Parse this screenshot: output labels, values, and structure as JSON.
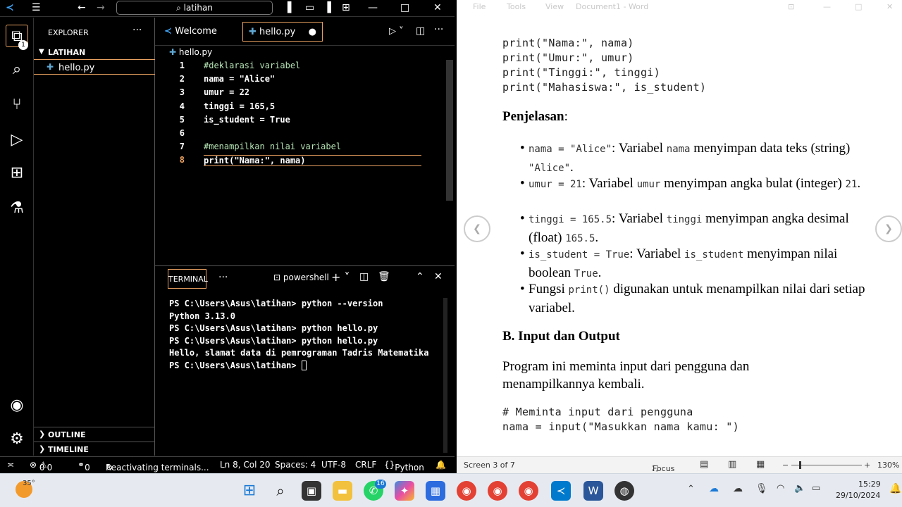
{
  "vscode": {
    "command_center": "latihan",
    "explorer_title": "EXPLORER",
    "folder_name": "LATIHAN",
    "file_name": "hello.py",
    "explorer_badge": "1",
    "tabs": [
      {
        "label": "Welcome"
      },
      {
        "label": "hello.py"
      }
    ],
    "breadcrumb": "hello.py",
    "code": [
      {
        "n": "1",
        "t": "#deklarasi variabel"
      },
      {
        "n": "2",
        "t": "nama = \"Alice\""
      },
      {
        "n": "3",
        "t": "umur = 22"
      },
      {
        "n": "4",
        "t": "tinggi = 165,5"
      },
      {
        "n": "5",
        "t": "is_student = True"
      },
      {
        "n": "6",
        "t": ""
      },
      {
        "n": "7",
        "t": "#menampilkan nilai variabel"
      },
      {
        "n": "8",
        "t": "print(\"Nama:\", nama)"
      }
    ],
    "terminal_tab": "TERMINAL",
    "shell": "powershell",
    "terminal_lines": [
      "PS C:\\Users\\Asus\\latihan> python --version",
      "Python 3.13.0",
      "PS C:\\Users\\Asus\\latihan> python hello.py",
      "PS C:\\Users\\Asus\\latihan> python hello.py",
      "Hello, slamat data di pemrograman Tadris Matematika",
      "PS C:\\Users\\Asus\\latihan> "
    ],
    "outline": "OUTLINE",
    "timeline": "TIMELINE",
    "status": {
      "errors": "0",
      "warnings": "0",
      "ports": "0",
      "message": "Reactivating terminals...",
      "position": "Ln 8, Col 20",
      "spaces": "Spaces: 4",
      "encoding": "UTF-8",
      "eol": "CRLF",
      "language": "Python"
    }
  },
  "word": {
    "menu": [
      "File",
      "Tools",
      "View"
    ],
    "title": "Document1 - Word",
    "code_top": [
      "print(\"Nama:\", nama)",
      "print(\"Umur:\", umur)",
      "print(\"Tinggi:\", tinggi)",
      "print(\"Mahasiswa:\", is_student)"
    ],
    "heading_penjelasan": "Penjelasan",
    "bullets": [
      {
        "code": "nama = \"Alice\"",
        "text": ": Variabel ",
        "code2": "nama",
        "text2": " menyimpan data teks (string) ",
        "code3": "\"Alice\"",
        "end": "."
      },
      {
        "code": "umur = 21",
        "text": ": Variabel ",
        "code2": "umur",
        "text2": " menyimpan angka bulat (integer) ",
        "code3": "21",
        "end": "."
      },
      {
        "code": "tinggi = 165.5",
        "text": ": Variabel ",
        "code2": "tinggi",
        "text2": " menyimpan angka desimal (float) ",
        "code3": "165.5",
        "end": "."
      },
      {
        "code": "is_student = True",
        "text": ": Variabel ",
        "code2": "is_student",
        "text2": " menyimpan nilai boolean ",
        "code3": "True",
        "end": "."
      }
    ],
    "bullet5_a": "Fungsi ",
    "bullet5_code": "print()",
    "bullet5_b": " digunakan untuk menampilkan nilai dari setiap variabel.",
    "section_b": "B. Input dan Output",
    "para": "Program ini meminta input dari pengguna dan",
    "para2": "menampilkannya kembali.",
    "code_bottom": [
      "# Meminta input dari pengguna",
      "nama = input(\"Masukkan nama kamu: \")"
    ],
    "status_screen": "Screen 3 of 7",
    "focus": "Focus",
    "zoom": "130%"
  },
  "taskbar": {
    "weather": "35°",
    "time": "15:29",
    "date": "29/10/2024",
    "whatsapp_badge": "16"
  }
}
